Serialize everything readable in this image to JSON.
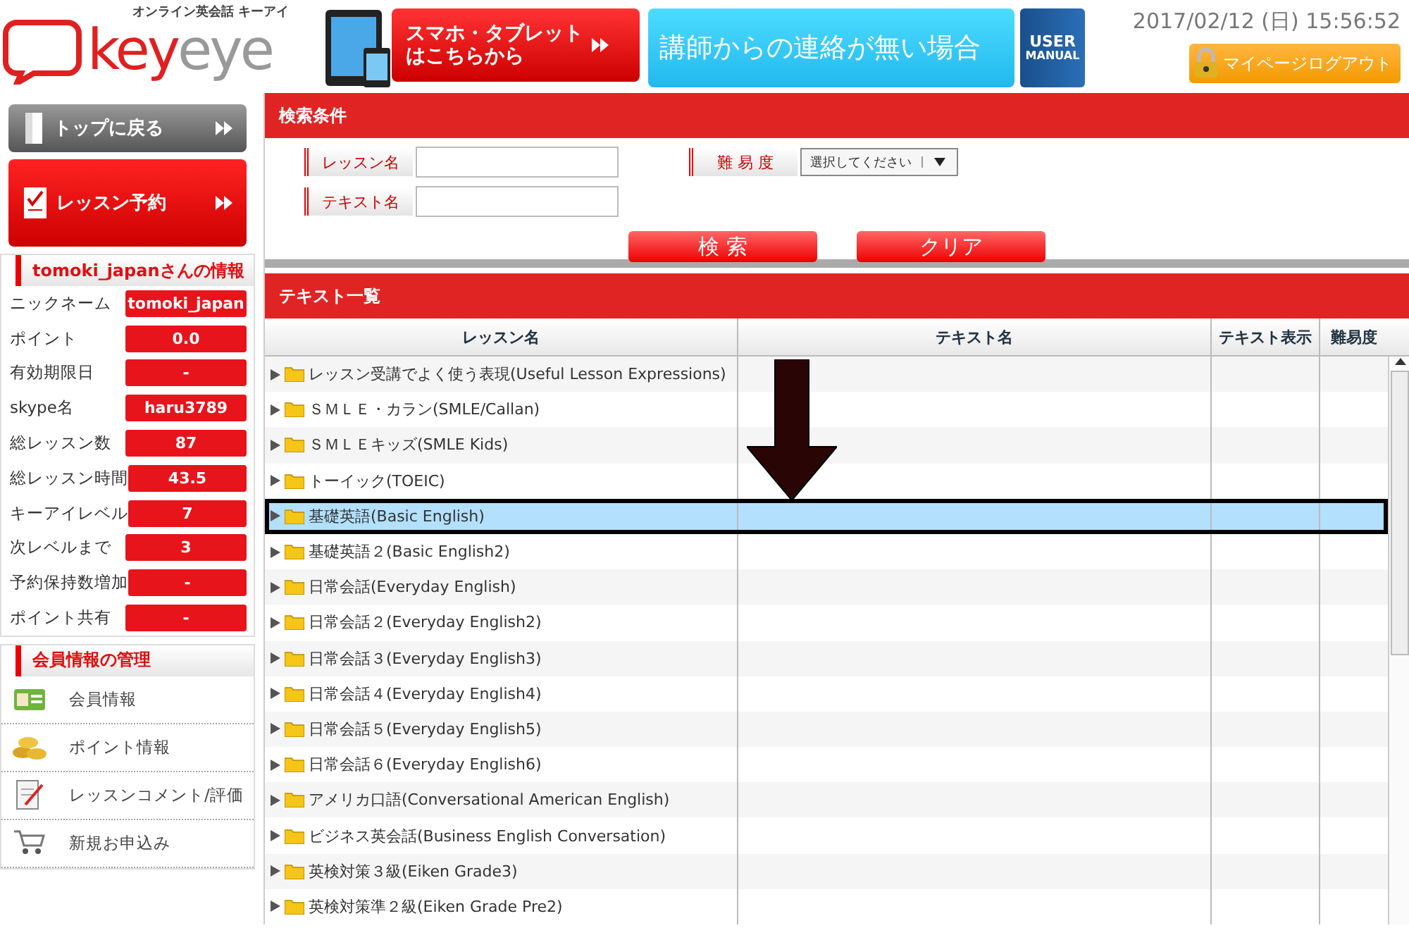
{
  "header": {
    "logo_tagline": "オンライン英会話 キーアイ",
    "logo_text_red": "key",
    "logo_text_grey": "eye",
    "banner_mobile": [
      "スマホ・タブレット",
      "はこちらから"
    ],
    "banner_contact": "講師からの連絡が無い場合",
    "manual": [
      "USER",
      "MANUAL"
    ],
    "datetime": "2017/02/12 (日) 15:56:52",
    "logout": "マイページログアウト"
  },
  "sidebar": {
    "top_button": "トップに戻る",
    "reserve_button": "レッスン予約",
    "info_title": "tomoki_japanさんの情報",
    "info_rows": [
      {
        "label": "ニックネーム",
        "value": "tomoki_japan"
      },
      {
        "label": "ポイント",
        "value": "0.0"
      },
      {
        "label": "有効期限日",
        "value": "-"
      },
      {
        "label": "skype名",
        "value": "haru3789"
      },
      {
        "label": "総レッスン数",
        "value": "87"
      },
      {
        "label": "総レッスン時間",
        "value": "43.5"
      },
      {
        "label": "キーアイレベル",
        "value": "7"
      },
      {
        "label": "次レベルまで",
        "value": "3"
      },
      {
        "label": "予約保持数増加",
        "value": "-"
      },
      {
        "label": "ポイント共有",
        "value": "-"
      }
    ],
    "manage_title": "会員情報の管理",
    "manage_items": [
      {
        "kind": "card",
        "label": "会員情報"
      },
      {
        "kind": "coins",
        "label": "ポイント情報"
      },
      {
        "kind": "memo",
        "label": "レッスンコメント/評価"
      },
      {
        "kind": "cart",
        "label": "新規お申込み"
      }
    ]
  },
  "search": {
    "title": "検索条件",
    "lesson_label": "レッスン名",
    "text_label": "テキスト名",
    "level_label": "難 易 度",
    "level_select": "選択してください",
    "search_button": "検 索",
    "clear_button": "クリア"
  },
  "list": {
    "title": "テキスト一覧",
    "columns": [
      "レッスン名",
      "テキスト名",
      "テキスト表示",
      "難易度"
    ],
    "rows": [
      {
        "name": "レッスン受講でよく使う表現(Useful Lesson Expressions)",
        "selected": false
      },
      {
        "name": "ＳＭＬＥ・カラン(SMLE/Callan)",
        "selected": false
      },
      {
        "name": "ＳＭＬＥキッズ(SMLE Kids)",
        "selected": false
      },
      {
        "name": "トーイック(TOEIC)",
        "selected": false
      },
      {
        "name": "基礎英語(Basic English)",
        "selected": true
      },
      {
        "name": "基礎英語２(Basic English2)",
        "selected": false
      },
      {
        "name": "日常会話(Everyday English)",
        "selected": false
      },
      {
        "name": "日常会話２(Everyday English2)",
        "selected": false
      },
      {
        "name": "日常会話３(Everyday English3)",
        "selected": false
      },
      {
        "name": "日常会話４(Everyday English4)",
        "selected": false
      },
      {
        "name": "日常会話５(Everyday English5)",
        "selected": false
      },
      {
        "name": "日常会話６(Everyday English6)",
        "selected": false
      },
      {
        "name": "アメリカ口語(Conversational American English)",
        "selected": false
      },
      {
        "name": "ビジネス英会話(Business English Conversation)",
        "selected": false
      },
      {
        "name": "英検対策３級(Eiken Grade3)",
        "selected": false
      },
      {
        "name": "英検対策準２級(Eiken Grade Pre2)",
        "selected": false
      }
    ]
  }
}
